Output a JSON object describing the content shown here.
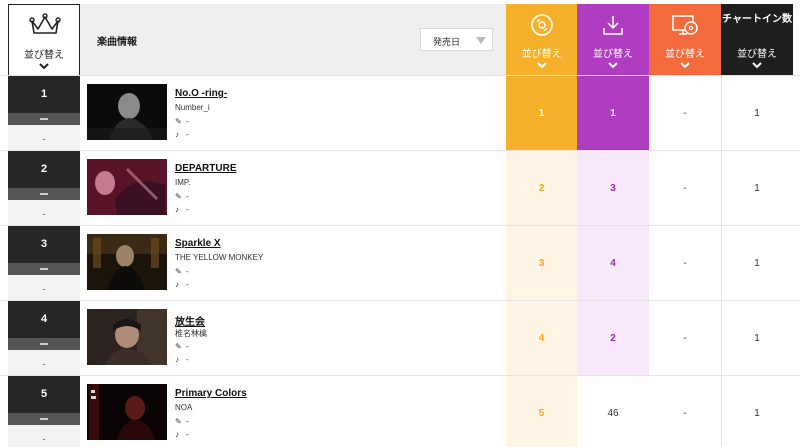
{
  "header": {
    "rank_sort_label": "並び替え",
    "song_info_label": "楽曲情報",
    "release_select": "発売日",
    "columns": [
      {
        "key": "streaming",
        "sort_label": "並び替え",
        "icon": "streaming-disc-icon",
        "color": "#f5b12b"
      },
      {
        "key": "download",
        "sort_label": "並び替え",
        "icon": "download-icon",
        "color": "#b03cc2"
      },
      {
        "key": "cd",
        "sort_label": "並び替え",
        "icon": "monitor-cd-icon",
        "color": "#f36a3c"
      },
      {
        "key": "chart_in",
        "title": "チャートイン数",
        "sort_label": "並び替え",
        "color": "#1e1e1e"
      }
    ]
  },
  "rows": [
    {
      "rank": "1",
      "prev": "-",
      "title": "No.O -ring-",
      "artist": "Number_i",
      "lyricist": "-",
      "composer": "-",
      "streaming": "1",
      "download": "1",
      "cd": "-",
      "chart_in": "1"
    },
    {
      "rank": "2",
      "prev": "-",
      "title": "DEPARTURE",
      "artist": "IMP.",
      "lyricist": "-",
      "composer": "-",
      "streaming": "2",
      "download": "3",
      "cd": "-",
      "chart_in": "1"
    },
    {
      "rank": "3",
      "prev": "-",
      "title": "Sparkle X",
      "artist": "THE YELLOW MONKEY",
      "lyricist": "-",
      "composer": "-",
      "streaming": "3",
      "download": "4",
      "cd": "-",
      "chart_in": "1"
    },
    {
      "rank": "4",
      "prev": "-",
      "title": "放生会",
      "artist": "椎名林檎",
      "lyricist": "-",
      "composer": "-",
      "streaming": "4",
      "download": "2",
      "cd": "-",
      "chart_in": "1"
    },
    {
      "rank": "5",
      "prev": "-",
      "title": "Primary Colors",
      "artist": "NOA",
      "lyricist": "-",
      "composer": "-",
      "streaming": "5",
      "download": "46",
      "cd": "-",
      "chart_in": "1"
    }
  ]
}
